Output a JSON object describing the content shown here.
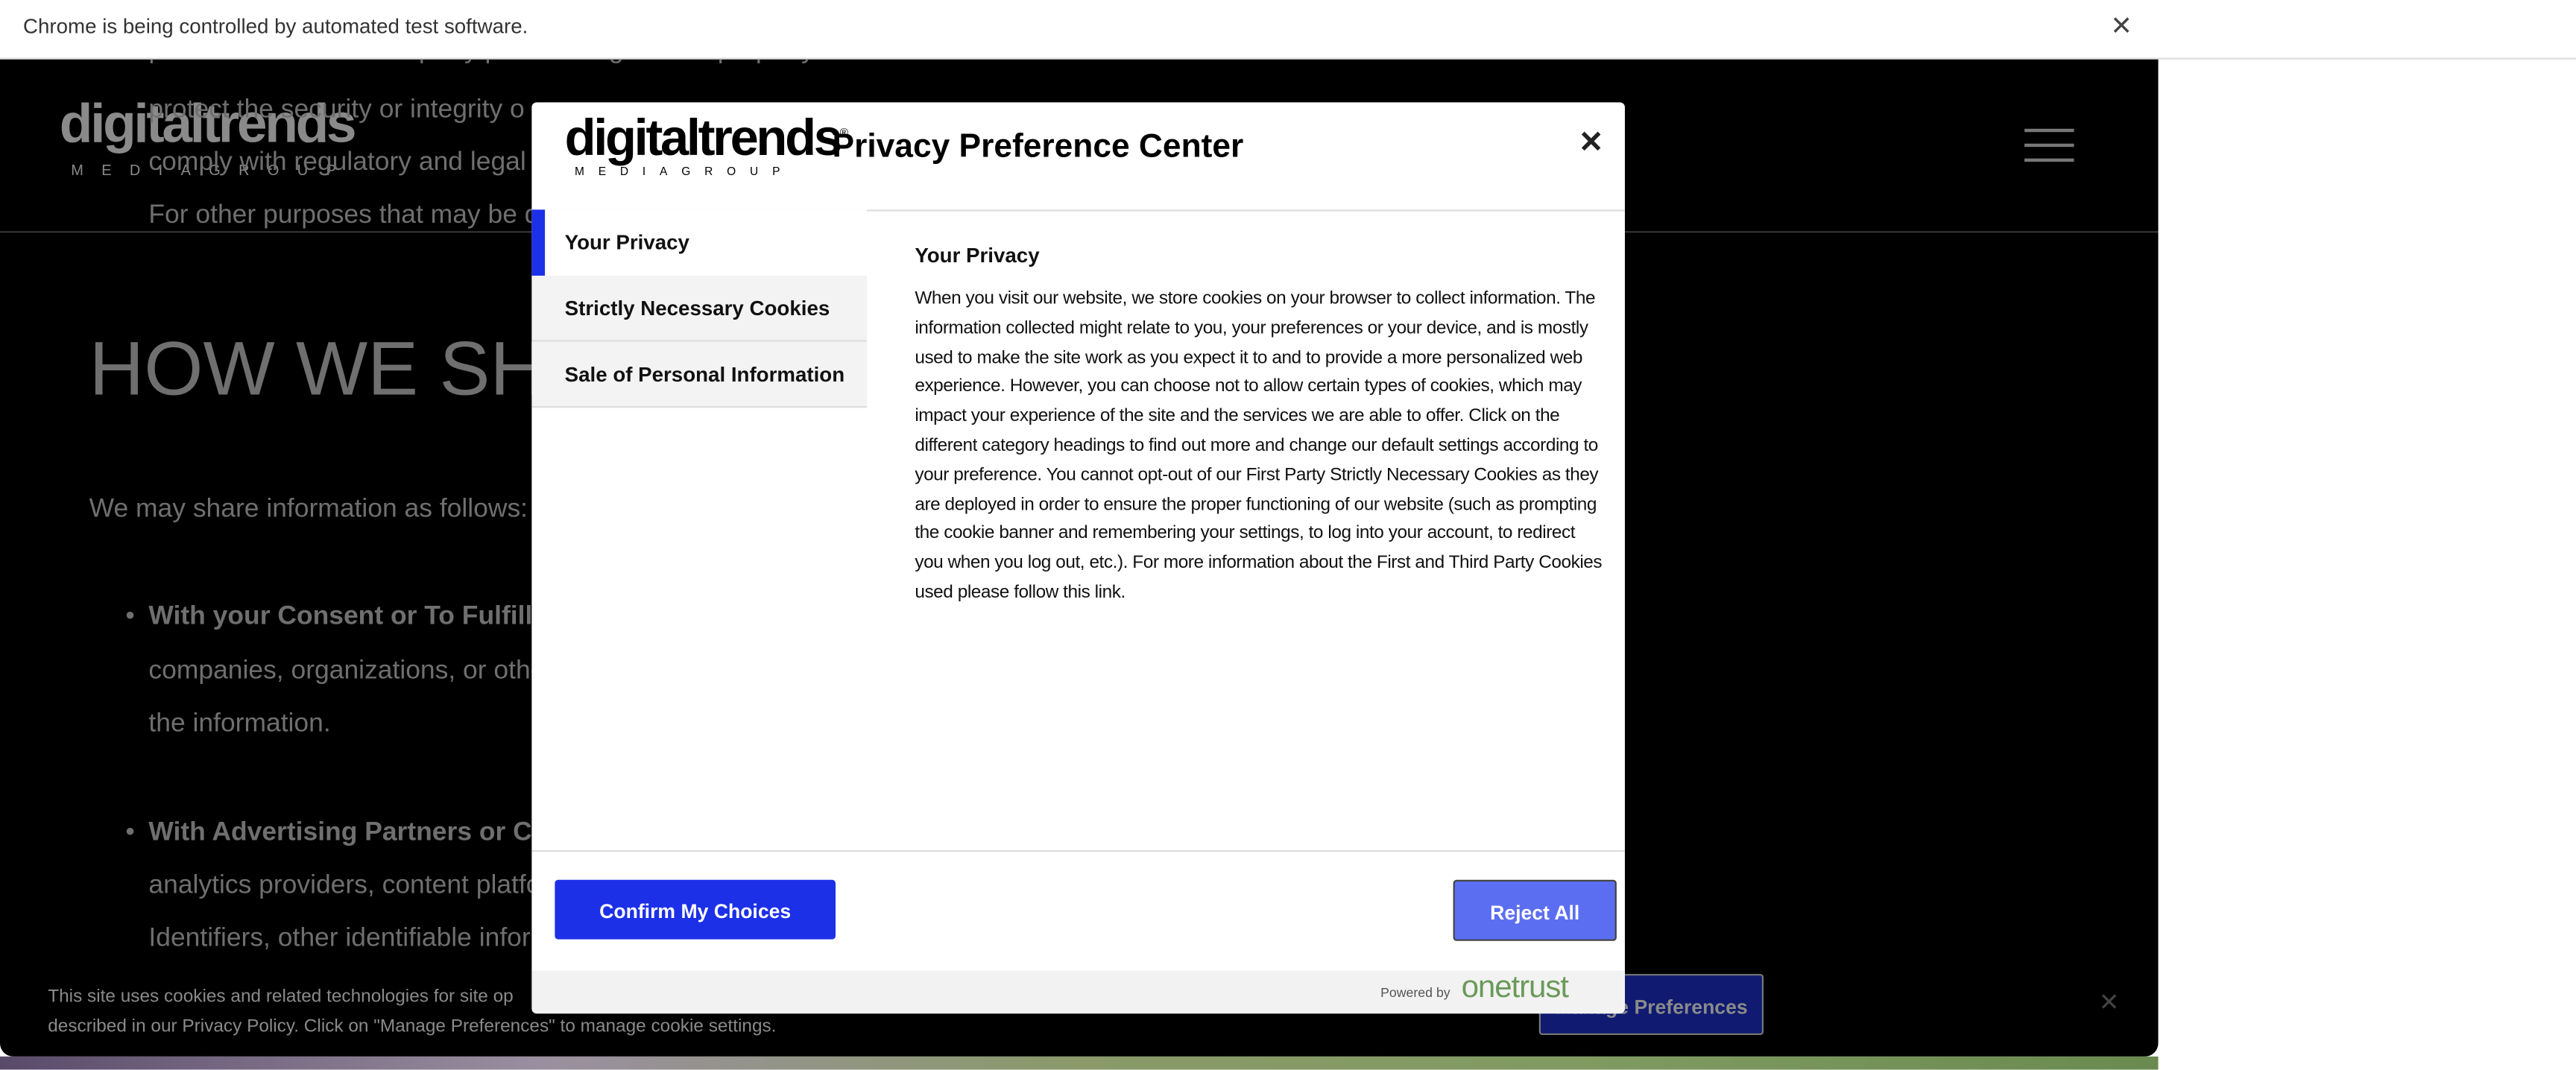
{
  "infobar": {
    "message": "Chrome is being controlled by automated test software.",
    "close": "✕"
  },
  "site": {
    "logo_main": "digitaltrends",
    "logo_sub": "MEDIAGROUP",
    "logo_reg": "®",
    "bullets_top": [
      "protect our or our third-party partner's rights and property.",
      "protect the security or integrity o",
      "comply with regulatory and legal",
      "For other purposes that may be d"
    ],
    "heading": "HOW WE SHA",
    "intro": "We may share information as follows:",
    "item1_bold": "With your Consent or To Fulfill",
    "item1_lines": [
      "companies, organizations, or othe",
      "the information."
    ],
    "item2_bold": "With Advertising Partners or C",
    "item2_lines": [
      "analytics providers, content platfo",
      "Identifiers, other identifiable infor"
    ]
  },
  "banner": {
    "line1": "This site uses cookies and related technologies for site op",
    "line2": "described in our Privacy Policy. Click on \"Manage Preferences\" to manage cookie settings.",
    "button": "Manage Preferences",
    "close": "✕"
  },
  "modal": {
    "logo_main": "digitaltrends",
    "logo_sub": "MEDIAGROUP",
    "logo_reg": "®",
    "title": "Privacy Preference Center",
    "close": "✕",
    "nav": [
      {
        "label": "Your Privacy"
      },
      {
        "label": "Strictly Necessary Cookies"
      },
      {
        "label": "Sale of Personal Information"
      }
    ],
    "content_title": "Your Privacy",
    "content_body": "When you visit our website, we store cookies on your browser to collect information. The information collected might relate to you, your preferences or your device, and is mostly used to make the site work as you expect it to and to provide a more personalized web experience. However, you can choose not to allow certain types of cookies, which may impact your experience of the site and the services we are able to offer. Click on the different category headings to find out more and change our default settings according to your preference. You cannot opt-out of our First Party Strictly Necessary Cookies as they are deployed in order to ensure the proper functioning of our website (such as prompting the cookie banner and remembering your settings, to log into your account, to redirect you when you log out, etc.). For more information about the First and Third Party Cookies used please follow this link.",
    "confirm": "Confirm My Choices",
    "reject": "Reject All",
    "powered_by": "Powered by",
    "powered_brand": "onetrust"
  },
  "colors": {
    "accent": "#1c30e8",
    "reject": "#5b6ef2",
    "onetrust": "#6a9a5a"
  }
}
